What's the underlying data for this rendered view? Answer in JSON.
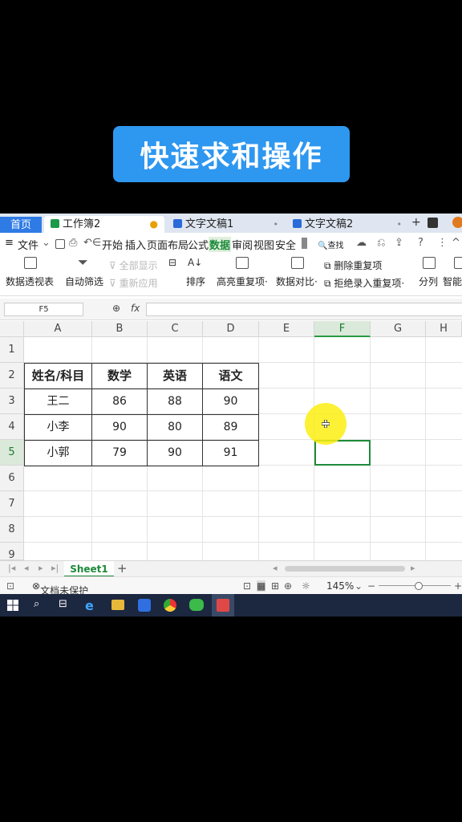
{
  "banner": {
    "title": "快速求和操作"
  },
  "tabs": {
    "home": "首页",
    "active": "工作簿2",
    "doc1": "文字文稿1",
    "doc2": "文字文稿2"
  },
  "menu": {
    "file": "文件",
    "items": [
      "开始",
      "插入",
      "页面布局",
      "公式",
      "数据",
      "审阅",
      "视图",
      "安全"
    ],
    "selected": "数据",
    "search": "查找"
  },
  "ribbon": {
    "pivot": "数据透视表",
    "autofilter": "自动筛选",
    "show_all": "全部显示",
    "reapply": "重新应用",
    "sort": "排序",
    "highlight_dup": "高亮重复项",
    "compare": "数据对比",
    "remove_dup": "删除重复项",
    "reject_dup": "拒绝录入重复项",
    "split": "分列",
    "smart": "智能"
  },
  "formula_bar": {
    "cell_ref": "F5",
    "fx": "fx",
    "value": ""
  },
  "columns": [
    "A",
    "B",
    "C",
    "D",
    "E",
    "F",
    "G",
    "H"
  ],
  "rows": [
    "1",
    "2",
    "3",
    "4",
    "5",
    "6",
    "7",
    "8",
    "9"
  ],
  "selected_cell": "F5",
  "table": {
    "headers": [
      "姓名/科目",
      "数学",
      "英语",
      "语文"
    ],
    "rows": [
      [
        "王二",
        "86",
        "88",
        "90"
      ],
      [
        "小李",
        "90",
        "80",
        "89"
      ],
      [
        "小郭",
        "79",
        "90",
        "91"
      ]
    ]
  },
  "sheets": [
    "Sheet1"
  ],
  "status": {
    "protect": "文档未保护",
    "zoom": "145%"
  },
  "colors": {
    "accent": "#1c8a3a",
    "banner": "#2e97f0",
    "home_tab": "#2f7be6"
  }
}
